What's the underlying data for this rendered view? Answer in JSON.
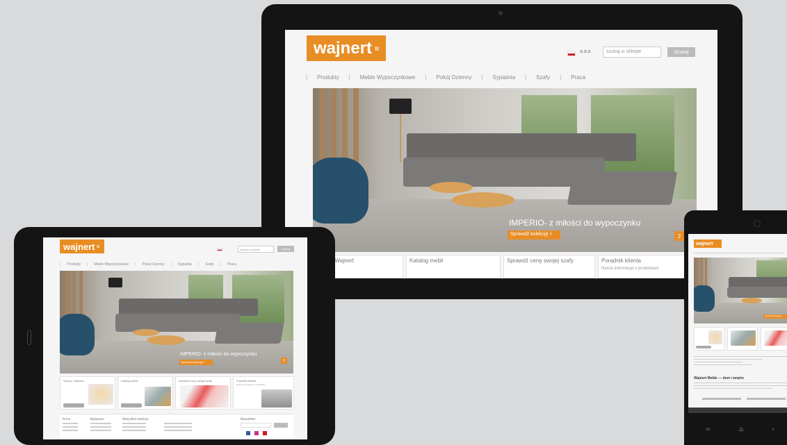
{
  "brand": {
    "logo_text": "wajnert",
    "accent": "#e88d24"
  },
  "header": {
    "search_placeholder": "szukaj w sklepie",
    "search_button": "Szukaj",
    "lang_label": "a.a.a"
  },
  "nav": [
    "Produkty",
    "Meble Wypoczynkowe",
    "Pokój Dzienny",
    "Sypialnia",
    "Szafy",
    "Praca"
  ],
  "hero": {
    "caption": "IMPERIO- z miłości do wypoczynku",
    "cta": "Sprawdź kolekcję >",
    "page": "2"
  },
  "tiles": [
    "Salony Wajnert",
    "Katalog mebli",
    "Sprawdź cenę swojej szafy",
    "Poradnik klienta"
  ],
  "tiles_tablet": [
    "Salony / Wybierz",
    "Katalog mebli",
    "Sprawdź cenę swojej szafy",
    "Poradnik klienta"
  ],
  "tile_desc": "Nasze informacje o produktach",
  "tablet_footer": {
    "col1": "Firma",
    "col2": "Najlepsze",
    "col3": "Wszystkie kolekcje",
    "newsletter": "Newsletter"
  },
  "phone": {
    "heading": "Wajnert Meble — dom i wnętrz",
    "nav_labels": [
      "=",
      "⌂",
      "‹"
    ]
  }
}
